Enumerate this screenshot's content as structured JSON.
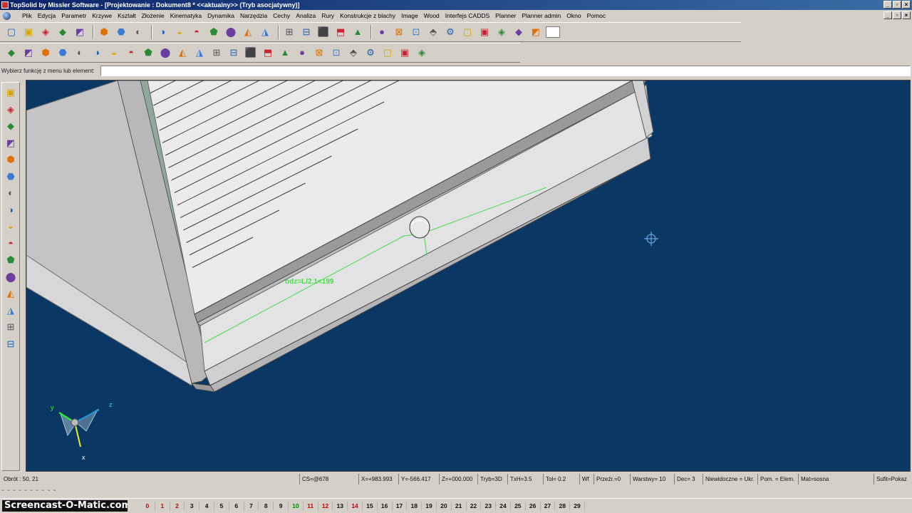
{
  "window": {
    "title": "TopSolid by Missler Software - [Projektowanie : Dokument8 *  <<aktualny>> (Tryb asocjatywny)]",
    "minimize": "_",
    "maximize": "▫",
    "close": "×"
  },
  "menu": [
    "Plik",
    "Edycja",
    "Parametr",
    "Krzywe",
    "Kształt",
    "Złożenie",
    "Kinematyka",
    "Dynamika",
    "Narzędzia",
    "Cechy",
    "Analiza",
    "Rury",
    "Konstrukcje z blachy",
    "Image",
    "Wood",
    "Interfejs CADDS",
    "Planner",
    "Planner admin",
    "Okno",
    "Pomoc"
  ],
  "toolbar1_icons": [
    "new-file-icon",
    "open-folder-icon",
    "save-icon",
    "info-icon",
    "print-icon",
    "delete-icon",
    "undo-icon",
    "erase-icon",
    "refresh-icon",
    "view-icon",
    "tool-a-icon",
    "tool-b-icon",
    "tool-c-icon",
    "tool-d-icon",
    "measure-icon",
    "pointer-icon",
    "cut-icon",
    "column-icon",
    "bend-icon",
    "wave-icon",
    "zoom-icon",
    "fit-icon",
    "move-icon",
    "rotate-icon",
    "view-cube-icon",
    "render-icon",
    "layer-a-icon",
    "layer-b-icon",
    "layer-c-icon",
    "layer-d-icon"
  ],
  "toolbar2_icons": [
    "shape-1-icon",
    "shape-2-icon",
    "shape-3-icon",
    "shape-4-icon",
    "shape-5-icon",
    "shape-6-icon",
    "shape-7-icon",
    "shape-8-icon",
    "shape-9-icon",
    "shape-10-icon",
    "shape-11-icon",
    "shape-12-icon",
    "shape-13-icon",
    "shape-14-icon",
    "shape-15-icon",
    "shape-16-icon",
    "shape-17-icon",
    "cube-icon",
    "cylinder-icon",
    "cone-icon",
    "sphere-icon",
    "grid-a-icon",
    "grid-b-icon",
    "material-icon",
    "options-icon"
  ],
  "left_toolbar_icons": [
    "pencil-icon",
    "curve-icon",
    "solid-icon",
    "shape-icon",
    "paint-icon",
    "circle-icon",
    "globe-icon",
    "gear-icon",
    "surface-icon",
    "part-icon",
    "ruler-icon",
    "color-icon",
    "sphere-icon",
    "box-icon",
    "column-icon",
    "component-icon"
  ],
  "prompt": {
    "label": "Wybierz funkcję z menu lub element:",
    "value": ""
  },
  "viewport": {
    "background": "#0b3764",
    "dimension_label": "odz=L/2.1<199",
    "axis_x": "x",
    "axis_y": "y",
    "axis_z": "z"
  },
  "status": [
    "Obrót : 50, 21",
    "CS=@678",
    "X=+983.993",
    "Y=-566.417",
    "Z=+000.000",
    "Tryb=3D",
    "TxH=3.5",
    "Tol=  0.2",
    "Wf",
    "Przeźr.=0",
    "Warstwy= 10",
    "Dec= 3",
    "Niewidoczne = Ukr.",
    "Pom. = Elem.",
    "Mat=sosna",
    "Sufit=Pokaz"
  ],
  "scroll_dashes": "- - - - - - - - - -",
  "brand": "Screencast-O-Matic.com",
  "layers": [
    {
      "n": "0",
      "c": "red"
    },
    {
      "n": "1",
      "c": "red"
    },
    {
      "n": "2",
      "c": "red"
    },
    {
      "n": "3",
      "c": "black"
    },
    {
      "n": "4",
      "c": "black"
    },
    {
      "n": "5",
      "c": "black"
    },
    {
      "n": "6",
      "c": "black"
    },
    {
      "n": "7",
      "c": "black"
    },
    {
      "n": "8",
      "c": "black"
    },
    {
      "n": "9",
      "c": "black"
    },
    {
      "n": "10",
      "c": "green"
    },
    {
      "n": "11",
      "c": "red"
    },
    {
      "n": "12",
      "c": "red"
    },
    {
      "n": "13",
      "c": "black"
    },
    {
      "n": "14",
      "c": "red"
    },
    {
      "n": "15",
      "c": "black"
    },
    {
      "n": "16",
      "c": "black"
    },
    {
      "n": "17",
      "c": "black"
    },
    {
      "n": "18",
      "c": "black"
    },
    {
      "n": "19",
      "c": "black"
    },
    {
      "n": "20",
      "c": "black"
    },
    {
      "n": "21",
      "c": "black"
    },
    {
      "n": "22",
      "c": "black"
    },
    {
      "n": "23",
      "c": "black"
    },
    {
      "n": "24",
      "c": "black"
    },
    {
      "n": "25",
      "c": "black"
    },
    {
      "n": "26",
      "c": "black"
    },
    {
      "n": "27",
      "c": "black"
    },
    {
      "n": "28",
      "c": "black"
    },
    {
      "n": "29",
      "c": "black"
    }
  ]
}
